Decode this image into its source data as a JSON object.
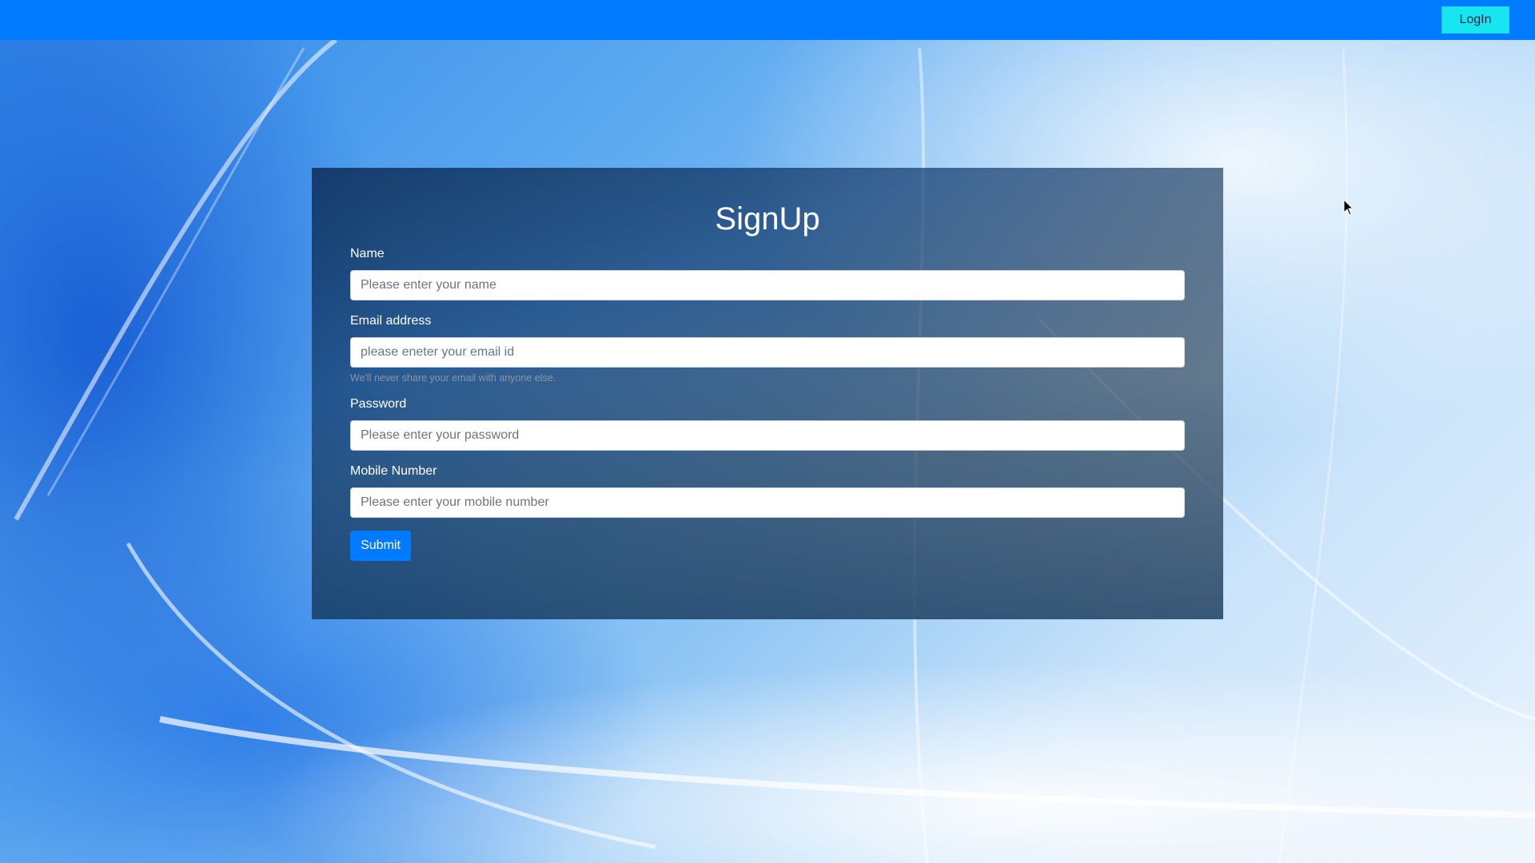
{
  "navbar": {
    "login_label": "LogIn"
  },
  "form": {
    "title": "SignUp",
    "fields": {
      "name": {
        "label": "Name",
        "placeholder": "Please enter your name"
      },
      "email": {
        "label": "Email address",
        "placeholder": "please eneter your email id",
        "help": "We'll never share your email with anyone else."
      },
      "password": {
        "label": "Password",
        "placeholder": "Please enter your password"
      },
      "mobile": {
        "label": "Mobile Number",
        "placeholder": "Please enter your mobile number"
      }
    },
    "submit_label": "Submit"
  },
  "colors": {
    "navbar": "#007bff",
    "login_button": "#17e6f0",
    "submit_button": "#007bff"
  },
  "icons": {
    "cursor": "mouse-pointer-icon"
  }
}
